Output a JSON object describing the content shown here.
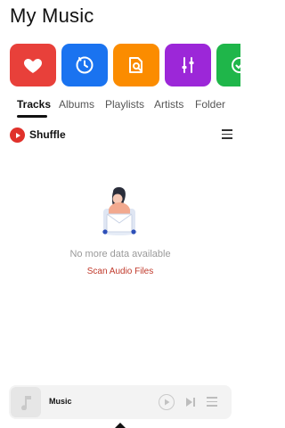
{
  "header": {
    "title": "My Music"
  },
  "shortcuts": [
    {
      "icon": "heart-icon",
      "color": "#e8403a"
    },
    {
      "icon": "history-clock-icon",
      "color": "#1a73f0"
    },
    {
      "icon": "folder-search-icon",
      "color": "#fb8c00"
    },
    {
      "icon": "equalizer-icon",
      "color": "#9c27d8"
    },
    {
      "icon": "check-circle-icon",
      "color": "#1fb64a"
    }
  ],
  "tabs": [
    {
      "label": "Tracks",
      "active": true
    },
    {
      "label": "Albums",
      "active": false
    },
    {
      "label": "Playlists",
      "active": false
    },
    {
      "label": "Artists",
      "active": false
    },
    {
      "label": "Folder",
      "active": false
    }
  ],
  "shuffle": {
    "label": "Shuffle"
  },
  "empty_state": {
    "message": "No more data available",
    "action_label": "Scan Audio Files"
  },
  "mini_player": {
    "title": "Music"
  },
  "colors": {
    "accent": "#e0312b",
    "link": "#c0392b"
  }
}
